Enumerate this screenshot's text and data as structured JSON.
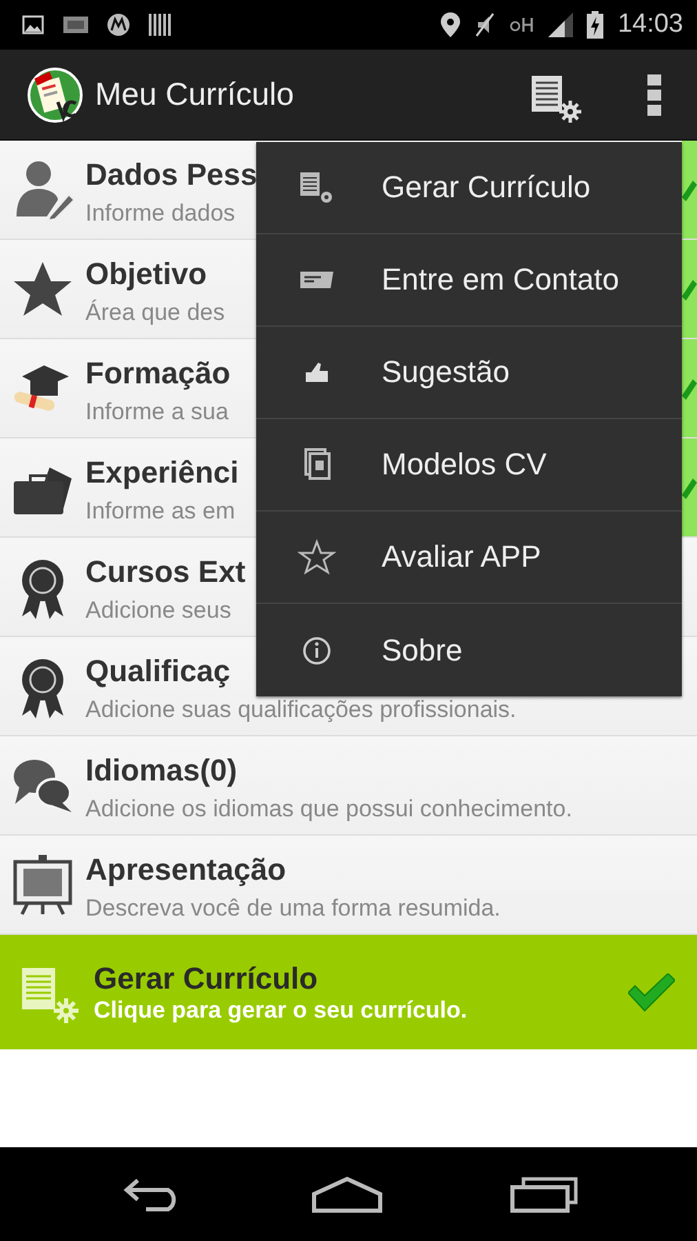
{
  "status_bar": {
    "time": "14:03"
  },
  "action_bar": {
    "title": "Meu Currículo"
  },
  "sections": [
    {
      "title": "Dados Pess",
      "subtitle": "Informe dados",
      "completed": true
    },
    {
      "title": "Objetivo",
      "subtitle": "Área que des",
      "completed": true
    },
    {
      "title": "Formação",
      "subtitle": "Informe a sua",
      "completed": true
    },
    {
      "title": "Experiênci",
      "subtitle": "Informe as em",
      "completed": true
    },
    {
      "title": "Cursos Ext",
      "subtitle": "Adicione seus",
      "completed": false
    },
    {
      "title": "Qualificaç",
      "subtitle": "Adicione suas qualificações profissionais.",
      "completed": false
    },
    {
      "title": "Idiomas(0)",
      "subtitle": "Adicione os idiomas que possui conhecimento.",
      "completed": false
    },
    {
      "title": "Apresentação",
      "subtitle": "Descreva você de uma forma resumida.",
      "completed": false
    }
  ],
  "generate_banner": {
    "title": "Gerar Currículo",
    "subtitle": "Clique para gerar o seu currículo.",
    "completed": true
  },
  "overflow_menu": {
    "items": [
      "Gerar Currículo",
      "Entre em Contato",
      "Sugestão",
      "Modelos CV",
      "Avaliar APP",
      "Sobre"
    ]
  }
}
